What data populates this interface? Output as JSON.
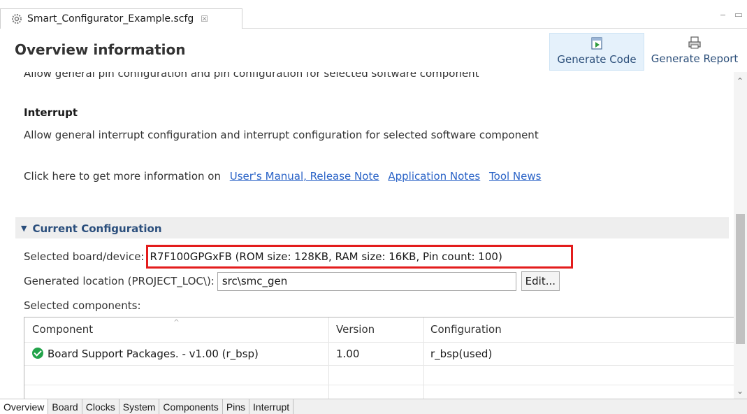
{
  "editor_tab": {
    "title": "Smart_Configurator_Example.scfg",
    "close_glyph": "☒"
  },
  "window_controls": {
    "minimize": "▭",
    "maximize": "▭"
  },
  "header": {
    "title": "Overview information",
    "generate_code": "Generate Code",
    "generate_report": "Generate Report"
  },
  "content": {
    "clipped_text": "Allow general pin configuration and pin configuration for selected software component",
    "interrupt_heading": "Interrupt",
    "interrupt_desc": "Allow general interrupt configuration and interrupt configuration for selected software component",
    "more_info_prefix": "Click here to get more information on",
    "links": [
      "User's Manual, Release Note",
      "Application Notes",
      "Tool News"
    ]
  },
  "current_configuration": {
    "heading": "Current Configuration",
    "board_label": "Selected board/device:",
    "board_value": "R7F100GPGxFB (ROM size: 128KB, RAM size: 16KB, Pin count: 100)",
    "location_label": "Generated location (PROJECT_LOC\\):",
    "location_value": "src\\smc_gen",
    "edit_button": "Edit...",
    "components_label": "Selected components:",
    "table": {
      "headers": [
        "Component",
        "Version",
        "Configuration"
      ],
      "rows": [
        {
          "component": "Board Support Packages. - v1.00 (r_bsp)",
          "version": "1.00",
          "configuration": "r_bsp(used)"
        }
      ]
    }
  },
  "bottom_tabs": [
    "Overview",
    "Board",
    "Clocks",
    "System",
    "Components",
    "Pins",
    "Interrupt"
  ],
  "colors": {
    "link": "#2a63c7",
    "section_header": "#2a4e7c",
    "highlight_box": "#e31c1c",
    "check_green": "#22a34a"
  },
  "icons": [
    "gear-icon",
    "generate-code-icon",
    "generate-report-icon",
    "check-circle-icon",
    "chevron-down-icon"
  ]
}
